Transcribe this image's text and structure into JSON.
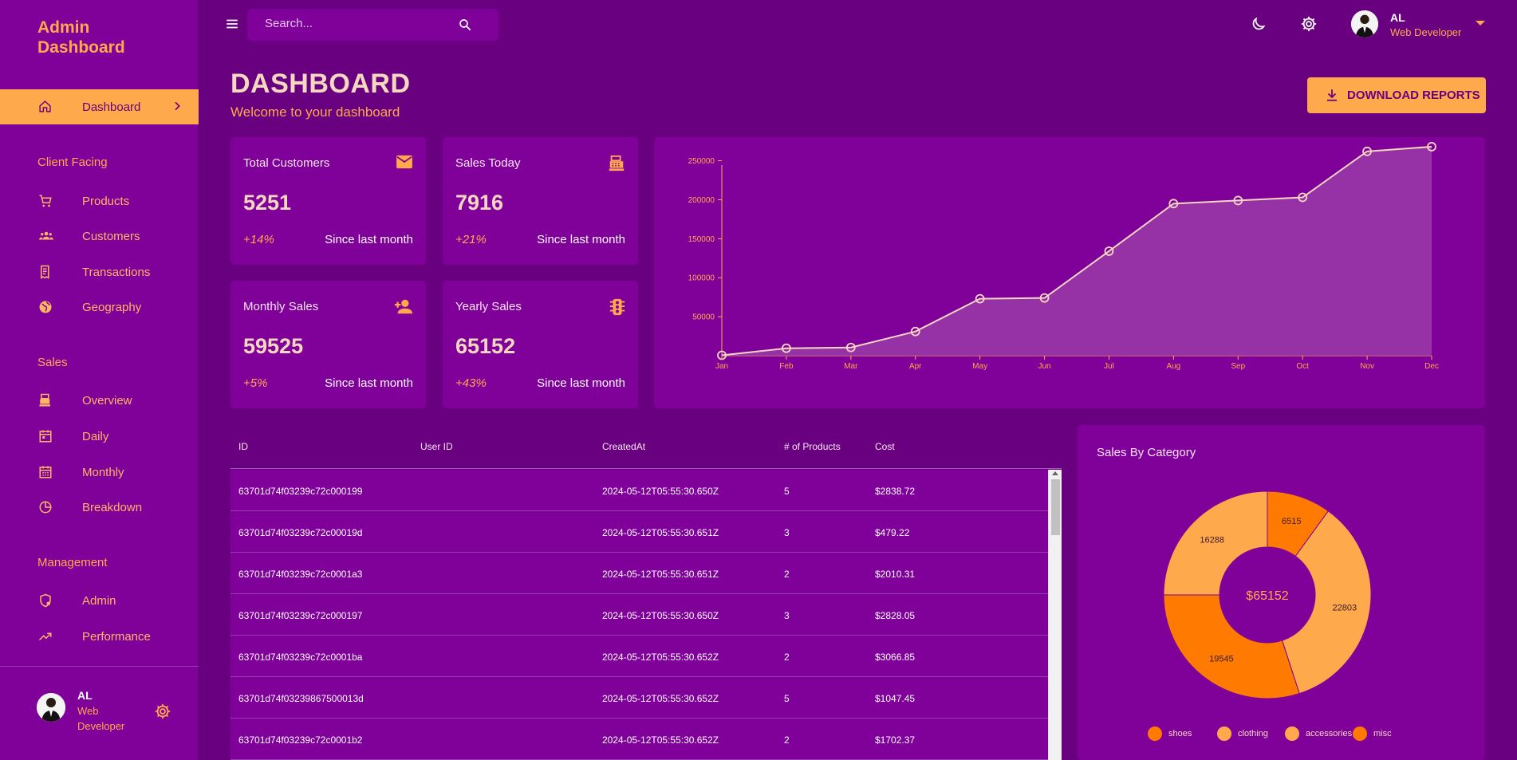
{
  "brand": {
    "line1": "Admin",
    "line2": "Dashboard"
  },
  "sidebar": {
    "active": {
      "label": "Dashboard",
      "icon": "home-icon"
    },
    "sections": [
      {
        "title": "Client Facing",
        "items": [
          {
            "label": "Products",
            "icon": "cart-icon"
          },
          {
            "label": "Customers",
            "icon": "group-icon"
          },
          {
            "label": "Transactions",
            "icon": "receipt-icon"
          },
          {
            "label": "Geography",
            "icon": "globe-icon"
          }
        ]
      },
      {
        "title": "Sales",
        "items": [
          {
            "label": "Overview",
            "icon": "point-of-sale-icon"
          },
          {
            "label": "Daily",
            "icon": "calendar-today-icon"
          },
          {
            "label": "Monthly",
            "icon": "calendar-month-icon"
          },
          {
            "label": "Breakdown",
            "icon": "pie-chart-icon"
          }
        ]
      },
      {
        "title": "Management",
        "items": [
          {
            "label": "Admin",
            "icon": "admin-icon"
          },
          {
            "label": "Performance",
            "icon": "trending-up-icon"
          }
        ]
      }
    ],
    "footer": {
      "name": "AL",
      "role": "Web Developer"
    }
  },
  "topbar": {
    "search_placeholder": "Search...",
    "user": {
      "name": "AL",
      "role": "Web Developer"
    }
  },
  "header": {
    "title": "DASHBOARD",
    "subtitle": "Welcome to your dashboard",
    "download_label": "DOWNLOAD REPORTS"
  },
  "stats": [
    {
      "title": "Total Customers",
      "value": "5251",
      "pct": "+14%",
      "since": "Since last month",
      "icon": "email-icon"
    },
    {
      "title": "Sales Today",
      "value": "7916",
      "pct": "+21%",
      "since": "Since last month",
      "icon": "point-of-sale-icon"
    },
    {
      "title": "Monthly Sales",
      "value": "59525",
      "pct": "+5%",
      "since": "Since last month",
      "icon": "person-add-icon"
    },
    {
      "title": "Yearly Sales",
      "value": "65152",
      "pct": "+43%",
      "since": "Since last month",
      "icon": "traffic-icon"
    }
  ],
  "chart_data": [
    {
      "type": "area",
      "categories": [
        "Jan",
        "Feb",
        "Mar",
        "Apr",
        "May",
        "Jun",
        "Jul",
        "Aug",
        "Sep",
        "Oct",
        "Nov",
        "Dec"
      ],
      "values": [
        500,
        9500,
        10500,
        31000,
        73000,
        74000,
        134000,
        195000,
        199000,
        203000,
        262000,
        268000
      ],
      "yticks": [
        50000,
        100000,
        150000,
        200000,
        250000
      ],
      "ylim": [
        0,
        270000
      ],
      "title": "",
      "xlabel": "",
      "ylabel": "",
      "colors": {
        "line": "#f6d7c0",
        "fill": "#9a3aa8"
      }
    },
    {
      "type": "pie",
      "title": "Sales By Category",
      "categories": [
        "shoes",
        "clothing",
        "accessories",
        "misc"
      ],
      "values": [
        6515,
        22803,
        19545,
        16288
      ],
      "center_label": "$65152",
      "colors": [
        "#ff7a00",
        "#ffa94d",
        "#ff7a00",
        "#ffa94d"
      ],
      "legend": [
        {
          "label": "shoes",
          "color": "#ff7a00"
        },
        {
          "label": "clothing",
          "color": "#ffa94d"
        },
        {
          "label": "accessories",
          "color": "#ffa94d"
        },
        {
          "label": "misc",
          "color": "#ff7a00"
        }
      ]
    }
  ],
  "table": {
    "columns": [
      "ID",
      "User ID",
      "CreatedAt",
      "# of Products",
      "Cost"
    ],
    "rows": [
      {
        "id": "63701d74f03239c72c000199",
        "user_id": "",
        "created": "2024-05-12T05:55:30.650Z",
        "products": "5",
        "cost": "$2838.72"
      },
      {
        "id": "63701d74f03239c72c00019d",
        "user_id": "",
        "created": "2024-05-12T05:55:30.651Z",
        "products": "3",
        "cost": "$479.22"
      },
      {
        "id": "63701d74f03239c72c0001a3",
        "user_id": "",
        "created": "2024-05-12T05:55:30.651Z",
        "products": "2",
        "cost": "$2010.31"
      },
      {
        "id": "63701d74f03239c72c000197",
        "user_id": "",
        "created": "2024-05-12T05:55:30.650Z",
        "products": "3",
        "cost": "$2828.05"
      },
      {
        "id": "63701d74f03239c72c0001ba",
        "user_id": "",
        "created": "2024-05-12T05:55:30.652Z",
        "products": "2",
        "cost": "$3066.85"
      },
      {
        "id": "63701d74f03239867500013d",
        "user_id": "",
        "created": "2024-05-12T05:55:30.652Z",
        "products": "5",
        "cost": "$1047.45"
      },
      {
        "id": "63701d74f03239c72c0001b2",
        "user_id": "",
        "created": "2024-05-12T05:55:30.652Z",
        "products": "2",
        "cost": "$1702.37"
      }
    ]
  },
  "colors": {
    "accent": "#ffa94d",
    "bg": "#690080",
    "panel": "#80009a"
  }
}
